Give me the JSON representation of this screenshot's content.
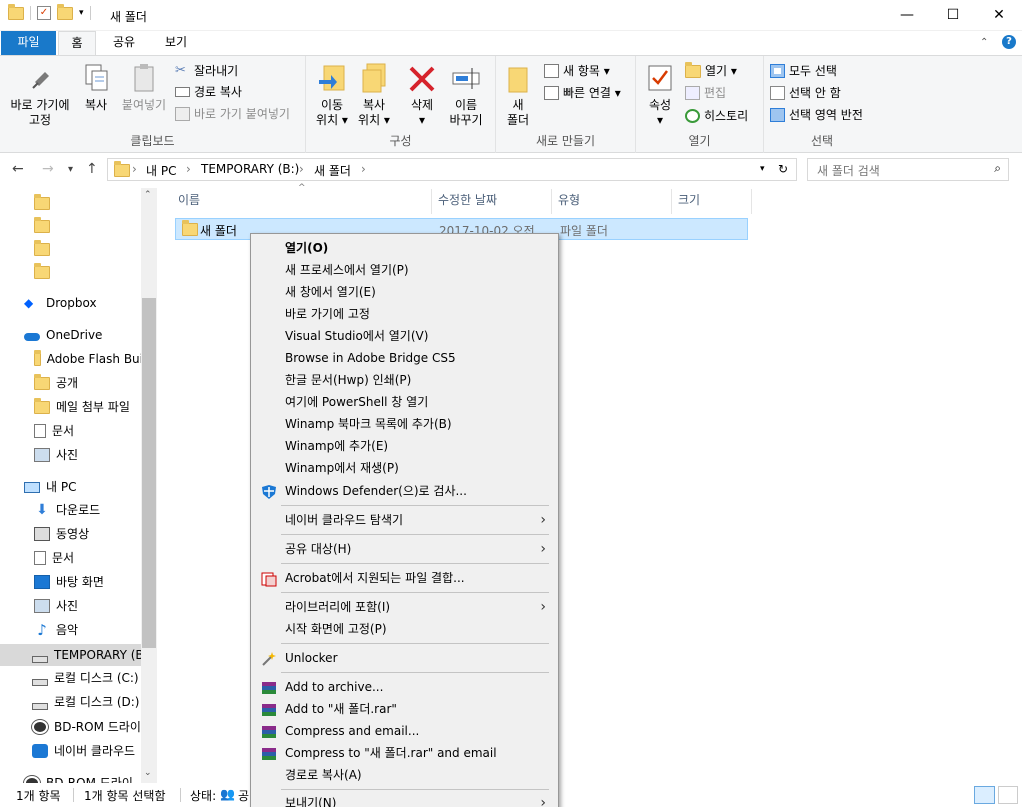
{
  "window": {
    "title": "새 폴더",
    "minimize": "—",
    "maximize": "☐",
    "close": "✕"
  },
  "tabs": {
    "file": "파일",
    "home": "홈",
    "share": "공유",
    "view": "보기"
  },
  "ribbon": {
    "clipboard": {
      "pin": "바로 가기에",
      "pin2": "고정",
      "copy": "복사",
      "paste": "붙여넣기",
      "cut": "잘라내기",
      "copy_path": "경로 복사",
      "paste_shortcut": "바로 가기 붙여넣기",
      "label": "클립보드"
    },
    "organize": {
      "move": "이동",
      "move2": "위치 ▾",
      "copy": "복사",
      "copy2": "위치 ▾",
      "delete": "삭제",
      "delete2": "▾",
      "rename": "이름",
      "rename2": "바꾸기",
      "label": "구성"
    },
    "new": {
      "new_folder": "새",
      "new_folder2": "폴더",
      "new_item": "새 항목 ▾",
      "easy_access": "빠른 연결 ▾",
      "label": "새로 만들기"
    },
    "open": {
      "properties": "속성",
      "properties2": "▾",
      "open": "열기 ▾",
      "edit": "편집",
      "history": "히스토리",
      "label": "열기"
    },
    "select": {
      "select_all": "모두 선택",
      "select_none": "선택 안 함",
      "invert": "선택 영역 반전",
      "label": "선택"
    }
  },
  "address": {
    "crumbs": [
      "내 PC",
      "TEMPORARY (B:)",
      "새 폴더"
    ],
    "search_placeholder": "새 폴더 검색"
  },
  "nav": {
    "dropbox": "Dropbox",
    "onedrive": "OneDrive",
    "od_items": [
      "Adobe Flash Bui",
      "공개",
      "메일 첨부 파일",
      "문서",
      "사진"
    ],
    "thispc": "내 PC",
    "pc_items": [
      "다운로드",
      "동영상",
      "문서",
      "바탕 화면",
      "사진",
      "음악",
      "TEMPORARY (B:",
      "로컬 디스크 (C:)",
      "로컬 디스크 (D:)",
      "BD-ROM 드라이",
      "네이버 클라우드",
      "BD-ROM 드라이"
    ]
  },
  "columns": {
    "name": "이름",
    "modified": "수정한 날짜",
    "type": "유형",
    "size": "크기"
  },
  "file": {
    "name": "새 폴더",
    "modified": "2017-10-02 오전",
    "type": "파일 폴더"
  },
  "context_menu": {
    "open": "열기(O)",
    "new_process": "새 프로세스에서 열기(P)",
    "new_window": "새 창에서 열기(E)",
    "pin_quick": "바로 가기에 고정",
    "vs": "Visual Studio에서 열기(V)",
    "bridge": "Browse in Adobe Bridge CS5",
    "hwp": "한글 문서(Hwp) 인쇄(P)",
    "powershell": "여기에 PowerShell 창 열기",
    "winamp_bookmark": "Winamp 북마크 목록에 추가(B)",
    "winamp_add": "Winamp에 추가(E)",
    "winamp_play": "Winamp에서 재생(P)",
    "defender": "Windows Defender(으)로 검사...",
    "naver": "네이버 클라우드 탐색기",
    "share": "공유 대상(H)",
    "acrobat": "Acrobat에서 지원되는 파일 결합...",
    "library": "라이브러리에 포함(I)",
    "pin_start": "시작 화면에 고정(P)",
    "unlocker": "Unlocker",
    "archive": "Add to archive...",
    "add_rar": "Add to \"새 폴더.rar\"",
    "compress_email": "Compress and email...",
    "compress_rar_email": "Compress to \"새 폴더.rar\" and email",
    "copy_path": "경로로 복사(A)",
    "send_to": "보내기(N)"
  },
  "status": {
    "count": "1개 항목",
    "selected": "1개 항목 선택함",
    "state": "상태:",
    "state_val": "공"
  }
}
